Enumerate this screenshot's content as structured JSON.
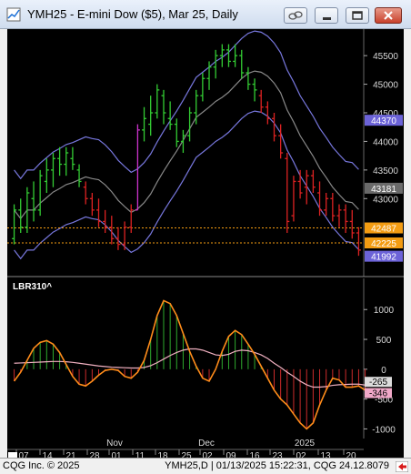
{
  "window": {
    "title": "YMH25 - E-mini Dow ($5), Mar 25, Daily"
  },
  "price_pane": {
    "y_ticks": [
      "45500",
      "45000",
      "44500",
      "44000",
      "43500",
      "43000"
    ],
    "labels": [
      {
        "text": "44370",
        "value": 44370,
        "color": "#6c63d8"
      },
      {
        "text": "43181",
        "value": 43181,
        "color": "#6a6a6a"
      },
      {
        "text": "42487",
        "value": 42487,
        "color": "#f39c12"
      },
      {
        "text": "42225",
        "value": 42225,
        "color": "#f39c12"
      },
      {
        "text": "41992",
        "value": 41992,
        "color": "#6c63d8"
      }
    ],
    "hlines": [
      42487,
      42225
    ],
    "ylim": [
      41700,
      45900
    ],
    "bars": [
      {
        "o": 42300,
        "h": 42900,
        "l": 42200,
        "c": 42800,
        "col": "g"
      },
      {
        "o": 42800,
        "h": 43000,
        "l": 42400,
        "c": 42500,
        "col": "g"
      },
      {
        "o": 42500,
        "h": 43200,
        "l": 42400,
        "c": 43100,
        "col": "g"
      },
      {
        "o": 43000,
        "h": 43300,
        "l": 42600,
        "c": 42800,
        "col": "g"
      },
      {
        "o": 42800,
        "h": 43500,
        "l": 42700,
        "c": 43400,
        "col": "g"
      },
      {
        "o": 43300,
        "h": 43700,
        "l": 43100,
        "c": 43500,
        "col": "g"
      },
      {
        "o": 43500,
        "h": 43800,
        "l": 43200,
        "c": 43700,
        "col": "g"
      },
      {
        "o": 43700,
        "h": 43900,
        "l": 43400,
        "c": 43600,
        "col": "g"
      },
      {
        "o": 43600,
        "h": 43900,
        "l": 43400,
        "c": 43800,
        "col": "g"
      },
      {
        "o": 43700,
        "h": 43900,
        "l": 43500,
        "c": 43600,
        "col": "g"
      },
      {
        "o": 43500,
        "h": 43600,
        "l": 43200,
        "c": 43300,
        "col": "g"
      },
      {
        "o": 43200,
        "h": 43300,
        "l": 42900,
        "c": 43000,
        "col": "r"
      },
      {
        "o": 43000,
        "h": 43100,
        "l": 42700,
        "c": 42800,
        "col": "r"
      },
      {
        "o": 42800,
        "h": 43000,
        "l": 42500,
        "c": 42600,
        "col": "r"
      },
      {
        "o": 42600,
        "h": 42800,
        "l": 42400,
        "c": 42500,
        "col": "r"
      },
      {
        "o": 42500,
        "h": 42700,
        "l": 42200,
        "c": 42300,
        "col": "r"
      },
      {
        "o": 42300,
        "h": 42500,
        "l": 42100,
        "c": 42200,
        "col": "r"
      },
      {
        "o": 42200,
        "h": 42600,
        "l": 42100,
        "c": 42500,
        "col": "r"
      },
      {
        "o": 42500,
        "h": 42900,
        "l": 42400,
        "c": 42800,
        "col": "r"
      },
      {
        "o": 42800,
        "h": 44300,
        "l": 42800,
        "c": 44200,
        "col": "m"
      },
      {
        "o": 44200,
        "h": 44600,
        "l": 44000,
        "c": 44400,
        "col": "g"
      },
      {
        "o": 44300,
        "h": 44800,
        "l": 44100,
        "c": 44500,
        "col": "g"
      },
      {
        "o": 44500,
        "h": 45000,
        "l": 44400,
        "c": 44900,
        "col": "g"
      },
      {
        "o": 44800,
        "h": 44900,
        "l": 44300,
        "c": 44500,
        "col": "g"
      },
      {
        "o": 44400,
        "h": 44700,
        "l": 44200,
        "c": 44300,
        "col": "g"
      },
      {
        "o": 44300,
        "h": 44400,
        "l": 43900,
        "c": 44000,
        "col": "g"
      },
      {
        "o": 44000,
        "h": 44200,
        "l": 43800,
        "c": 44100,
        "col": "g"
      },
      {
        "o": 44100,
        "h": 44600,
        "l": 44000,
        "c": 44500,
        "col": "g"
      },
      {
        "o": 44500,
        "h": 44900,
        "l": 44300,
        "c": 44800,
        "col": "g"
      },
      {
        "o": 44800,
        "h": 45200,
        "l": 44700,
        "c": 45100,
        "col": "g"
      },
      {
        "o": 45100,
        "h": 45400,
        "l": 44900,
        "c": 45300,
        "col": "g"
      },
      {
        "o": 45300,
        "h": 45600,
        "l": 45100,
        "c": 45500,
        "col": "g"
      },
      {
        "o": 45500,
        "h": 45700,
        "l": 45300,
        "c": 45600,
        "col": "g"
      },
      {
        "o": 45600,
        "h": 45700,
        "l": 45300,
        "c": 45400,
        "col": "g"
      },
      {
        "o": 45400,
        "h": 45700,
        "l": 45300,
        "c": 45500,
        "col": "g"
      },
      {
        "o": 45500,
        "h": 45600,
        "l": 45100,
        "c": 45200,
        "col": "g"
      },
      {
        "o": 45200,
        "h": 45300,
        "l": 44900,
        "c": 45000,
        "col": "g"
      },
      {
        "o": 45000,
        "h": 45100,
        "l": 44700,
        "c": 44900,
        "col": "g"
      },
      {
        "o": 44800,
        "h": 44900,
        "l": 44500,
        "c": 44600,
        "col": "r"
      },
      {
        "o": 44600,
        "h": 44700,
        "l": 44300,
        "c": 44400,
        "col": "r"
      },
      {
        "o": 44400,
        "h": 44500,
        "l": 44000,
        "c": 44100,
        "col": "r"
      },
      {
        "o": 44100,
        "h": 44300,
        "l": 43700,
        "c": 43800,
        "col": "r"
      },
      {
        "o": 43700,
        "h": 43800,
        "l": 42400,
        "c": 42600,
        "col": "r"
      },
      {
        "o": 42700,
        "h": 43400,
        "l": 42600,
        "c": 43300,
        "col": "r"
      },
      {
        "o": 43300,
        "h": 43500,
        "l": 43000,
        "c": 43100,
        "col": "r"
      },
      {
        "o": 43200,
        "h": 43500,
        "l": 42900,
        "c": 43400,
        "col": "r"
      },
      {
        "o": 43400,
        "h": 43500,
        "l": 43100,
        "c": 43200,
        "col": "r"
      },
      {
        "o": 43100,
        "h": 43300,
        "l": 42700,
        "c": 42800,
        "col": "r"
      },
      {
        "o": 42800,
        "h": 43100,
        "l": 42700,
        "c": 43000,
        "col": "r"
      },
      {
        "o": 43000,
        "h": 43100,
        "l": 42600,
        "c": 42700,
        "col": "r"
      },
      {
        "o": 42700,
        "h": 42900,
        "l": 42500,
        "c": 42800,
        "col": "r"
      },
      {
        "o": 42800,
        "h": 42900,
        "l": 42400,
        "c": 42600,
        "col": "r"
      },
      {
        "o": 42600,
        "h": 42800,
        "l": 42300,
        "c": 42400,
        "col": "r"
      },
      {
        "o": 42400,
        "h": 42500,
        "l": 42000,
        "c": 42100,
        "col": "r"
      }
    ]
  },
  "indicator_pane": {
    "title": "LBR310^",
    "y_ticks": [
      "1000",
      "500",
      "0",
      "-500",
      "-1000"
    ],
    "ylim": [
      -1100,
      1400
    ],
    "labels": [
      {
        "text": "-265",
        "value": -265,
        "color": "#dcdcdc"
      },
      {
        "text": "-346",
        "value": -346,
        "color": "#f0a8c8"
      }
    ],
    "osc": [
      -200,
      -50,
      150,
      350,
      450,
      480,
      420,
      280,
      80,
      -120,
      -250,
      -280,
      -200,
      -100,
      -20,
      0,
      -20,
      -120,
      -150,
      -50,
      150,
      500,
      900,
      1150,
      1100,
      900,
      600,
      300,
      50,
      -150,
      -200,
      0,
      300,
      550,
      650,
      580,
      420,
      250,
      50,
      -150,
      -350,
      -500,
      -600,
      -750,
      -900,
      -1000,
      -900,
      -600,
      -350,
      -150,
      -180,
      -300,
      -300,
      -280,
      -350
    ],
    "signal": [
      100,
      105,
      110,
      115,
      120,
      125,
      130,
      130,
      125,
      115,
      100,
      85,
      70,
      55,
      45,
      35,
      30,
      25,
      20,
      20,
      30,
      60,
      110,
      170,
      230,
      280,
      320,
      340,
      340,
      320,
      280,
      240,
      230,
      250,
      300,
      320,
      310,
      280,
      240,
      180,
      100,
      30,
      -50,
      -120,
      -200,
      -260,
      -300,
      -300,
      -290,
      -270,
      -260,
      -255,
      -250,
      -250,
      -265
    ],
    "hist": [
      -200,
      -50,
      150,
      350,
      450,
      480,
      420,
      280,
      80,
      -120,
      -250,
      -280,
      -200,
      -100,
      -20,
      0,
      -20,
      -120,
      -150,
      -50,
      150,
      500,
      900,
      1150,
      1100,
      900,
      600,
      300,
      50,
      -150,
      -200,
      0,
      300,
      550,
      650,
      580,
      420,
      250,
      50,
      -150,
      -350,
      -500,
      -600,
      -750,
      -900,
      -1000,
      -900,
      -600,
      -350,
      -150,
      -180,
      -300,
      -300,
      -280,
      -350
    ]
  },
  "x_axis": {
    "day_ticks": [
      "07",
      "14",
      "21",
      "28",
      "01",
      "11",
      "18",
      "25",
      "02",
      "09",
      "16",
      "23",
      "02",
      "13",
      "20"
    ],
    "months": [
      "Nov",
      "Dec",
      "2025"
    ]
  },
  "status": {
    "left": "CQG Inc. © 2025",
    "right": "YMH25,D | 01/13/2025 15:22:31, CQG 24.12.8079"
  },
  "colors": {
    "up": "#33cc33",
    "down": "#dd2222",
    "reversal": "#cc33cc",
    "band": "#7777dd",
    "mid": "#888888",
    "osc": "#ff8c1a",
    "signal": "#f0b0c0"
  }
}
